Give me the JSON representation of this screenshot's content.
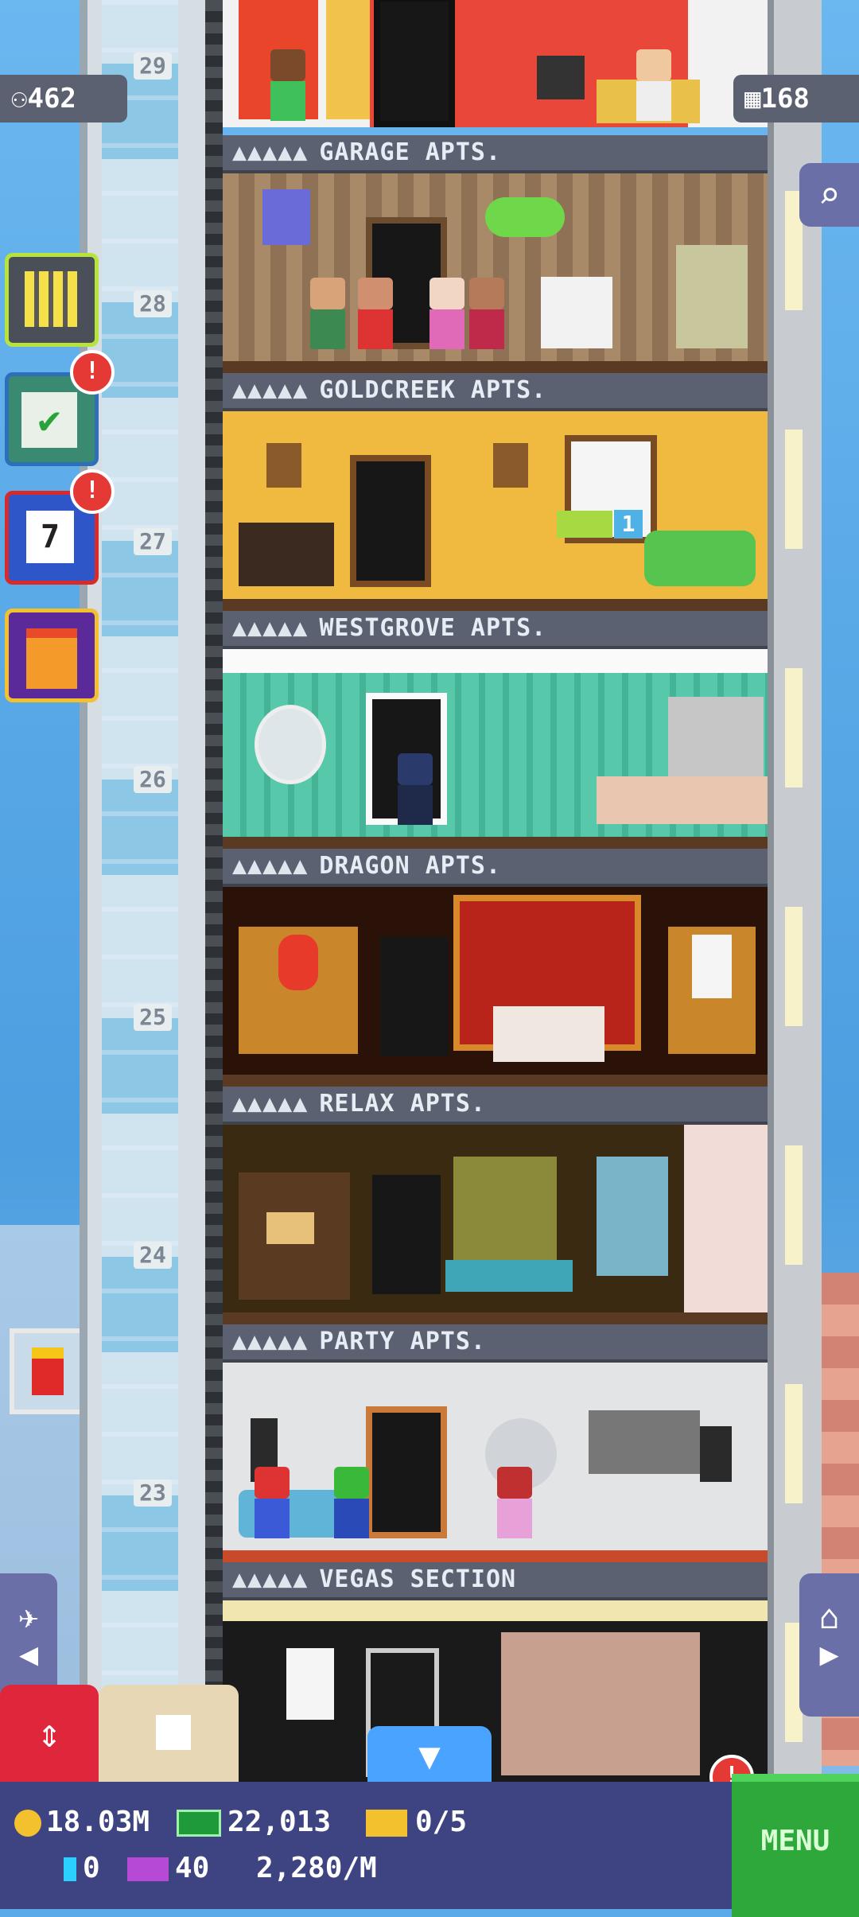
{
  "stats": {
    "population": "462",
    "stories": "168"
  },
  "floors": [
    {
      "number": "28",
      "label": "GARAGE APTS.",
      "people_icons": "▲▲▲▲▲"
    },
    {
      "number": "27",
      "label": "GOLDCREEK APTS.",
      "people_icons": "▲▲▲▲▲"
    },
    {
      "number": "26",
      "label": "WESTGROVE APTS.",
      "people_icons": "▲▲▲▲▲"
    },
    {
      "number": "25",
      "label": "DRAGON APTS.",
      "people_icons": "▲▲▲▲▲"
    },
    {
      "number": "24",
      "label": "RELAX APTS.",
      "people_icons": "▲▲▲▲▲"
    },
    {
      "number": "23",
      "label": "PARTY APTS.",
      "people_icons": "▲▲▲▲▲"
    },
    {
      "number": "",
      "label": "VEGAS SECTION",
      "people_icons": "▲▲▲▲▲"
    }
  ],
  "top_floor_number": "29",
  "goldcreek_counter": "1",
  "left_buttons": {
    "missions_badge": "!",
    "calendar_badge": "!",
    "calendar_day": "7"
  },
  "notification_badge": "!",
  "hud": {
    "coins": "18.03M",
    "bux_cash": "22,013",
    "tickets": "0/5",
    "tower_bux": "0",
    "vip": "40",
    "rate": "2,280/M",
    "menu_label": "MENU"
  },
  "colors": {
    "hud_bg": "#3e4482",
    "menu_green": "#2ea83a",
    "label_bg": "#5b6170"
  }
}
